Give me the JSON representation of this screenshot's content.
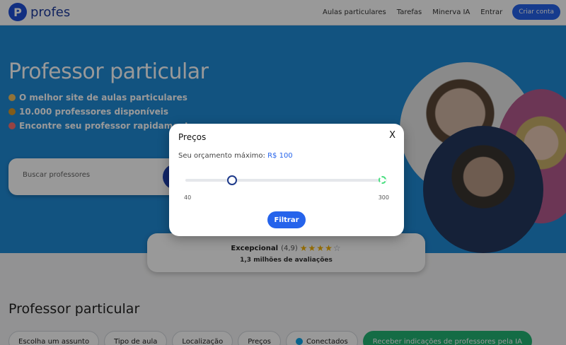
{
  "header": {
    "logo_text": "profes",
    "nav": [
      "Aulas particulares",
      "Tarefas",
      "Minerva IA",
      "Entrar"
    ],
    "cta_label": "Criar conta"
  },
  "hero": {
    "title": "Professor particular",
    "bullets": [
      {
        "text": "O melhor site de aulas particulares",
        "icon": "medal-icon",
        "color": "#f0c060"
      },
      {
        "text": "10.000 professores disponíveis",
        "icon": "books-icon",
        "color": "#d99a2b"
      },
      {
        "text": "Encontre seu professor rapidamente",
        "icon": "clock-icon",
        "color": "#f87171"
      }
    ],
    "search_placeholder": "Buscar professores"
  },
  "rating": {
    "label": "Excepcional",
    "score": "(4,9)",
    "stars_filled": 4,
    "stars_total": 5,
    "count_text": "1,3 milhões de avaliações"
  },
  "section": {
    "title": "Professor particular",
    "filters": [
      {
        "label": "Escolha um assunto",
        "style": "chip"
      },
      {
        "label": "Tipo de aula",
        "style": "chip"
      },
      {
        "label": "Localização",
        "style": "chip"
      },
      {
        "label": "Preços",
        "style": "chip"
      },
      {
        "label": "Conectados",
        "style": "chip-dot"
      },
      {
        "label": "Receber indicações de professores pela IA",
        "style": "chip-green"
      }
    ]
  },
  "modal": {
    "title": "Preços",
    "close_label": "X",
    "budget_label": "Seu orçamento máximo:",
    "budget_value": "R$ 100",
    "slider_min": 40,
    "slider_max": 300,
    "slider_value": 100,
    "filter_label": "Filtrar"
  },
  "colors": {
    "brand": "#1e4fd8",
    "hero_bg": "#1f8ad6",
    "accent": "#2563eb",
    "ia_chip": "#22b573"
  }
}
